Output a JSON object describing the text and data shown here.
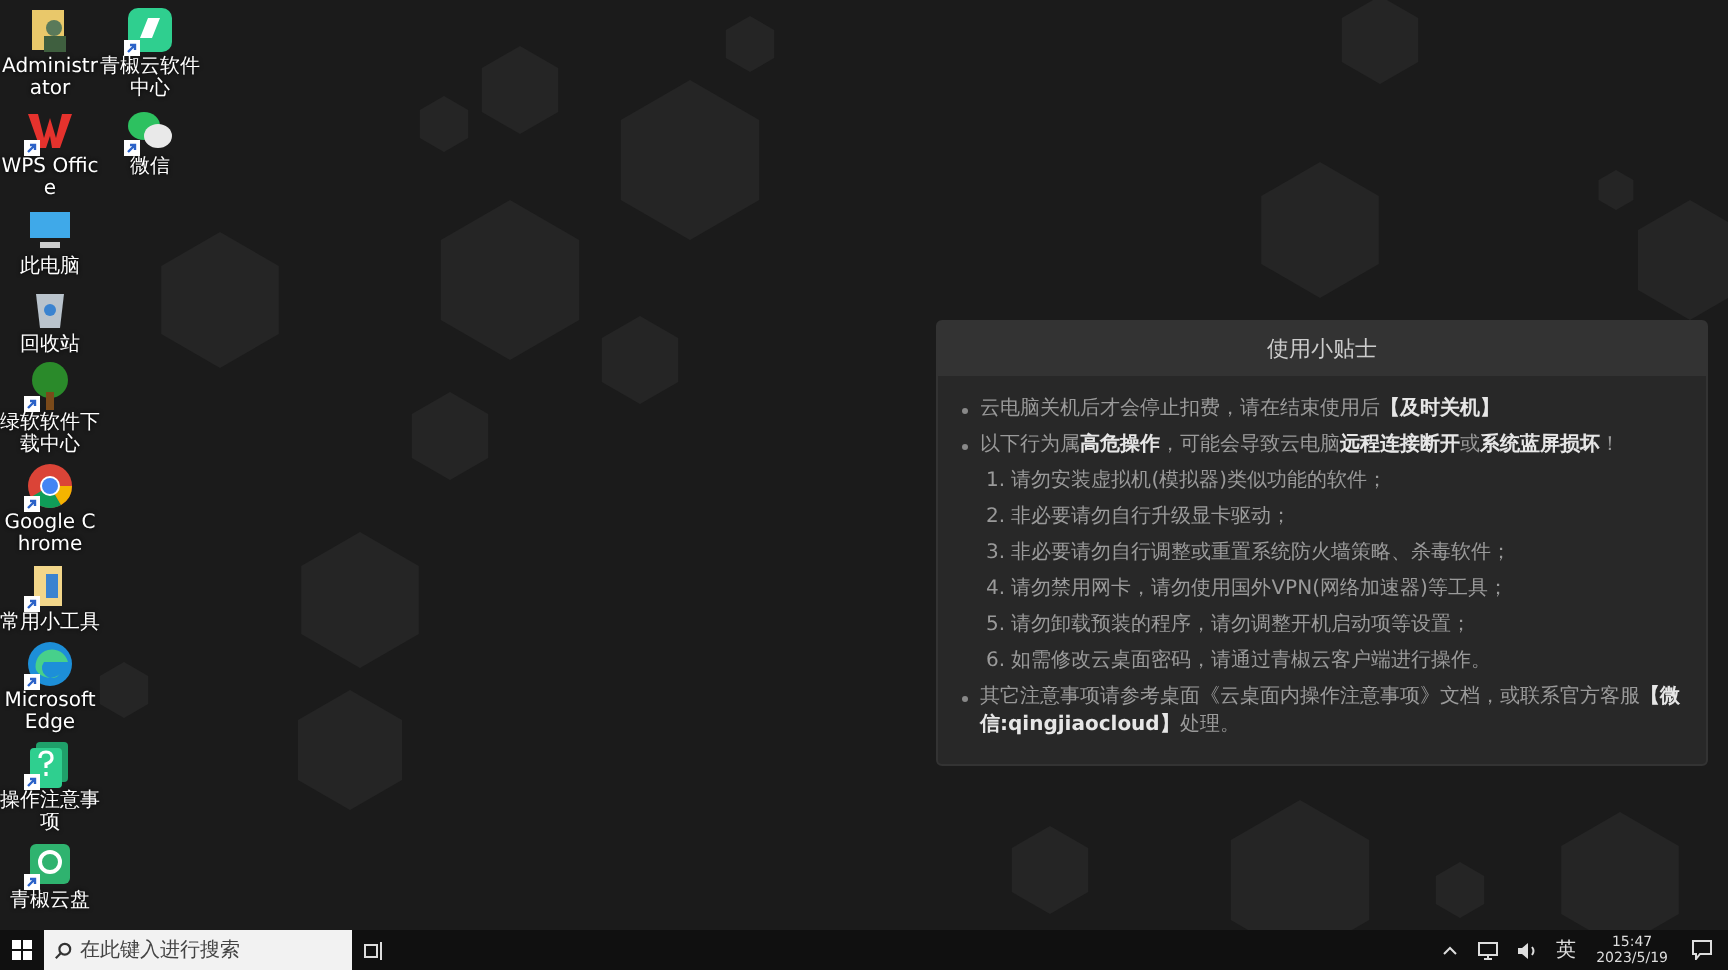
{
  "desktop": {
    "icon_rows": [
      {
        "icons": [
          {
            "label": "Administrator",
            "kind": "user-folder",
            "shortcut": false
          },
          {
            "label": "青椒云软件中心",
            "kind": "app-tile",
            "shortcut": true
          }
        ]
      },
      {
        "icons": [
          {
            "label": "WPS Office",
            "kind": "wps",
            "shortcut": true
          },
          {
            "label": "微信",
            "kind": "chat",
            "shortcut": true
          }
        ]
      },
      {
        "icons": [
          {
            "label": "此电脑",
            "kind": "computer",
            "shortcut": false
          }
        ]
      },
      {
        "icons": [
          {
            "label": "回收站",
            "kind": "recycle-bin",
            "shortcut": false
          }
        ]
      },
      {
        "icons": [
          {
            "label": "绿软软件下载中心",
            "kind": "tree",
            "shortcut": true
          }
        ]
      },
      {
        "icons": [
          {
            "label": "Google Chrome",
            "kind": "chrome",
            "shortcut": true
          }
        ]
      },
      {
        "icons": [
          {
            "label": "常用小工具",
            "kind": "folder",
            "shortcut": true
          }
        ]
      },
      {
        "icons": [
          {
            "label": "Microsoft Edge",
            "kind": "edge",
            "shortcut": true
          }
        ]
      },
      {
        "icons": [
          {
            "label": "操作注意事项",
            "kind": "help-doc",
            "shortcut": true
          }
        ]
      },
      {
        "icons": [
          {
            "label": "青椒云盘",
            "kind": "cloud-drive",
            "shortcut": true
          }
        ]
      }
    ]
  },
  "tips": {
    "title": "使用小贴士",
    "items": [
      {
        "kind": "bullet",
        "text": "云电脑关机后才会停止扣费，请在结束使用后**【及时关机】**"
      },
      {
        "kind": "bullet",
        "text": "以下行为属**高危操作**，可能会导致云电脑**远程连接断开**或**系统蓝屏损坏**！"
      },
      {
        "kind": "numbered",
        "text": "1. 请勿安装虚拟机(模拟器)类似功能的软件；"
      },
      {
        "kind": "numbered",
        "text": "2. 非必要请勿自行升级显卡驱动；"
      },
      {
        "kind": "numbered",
        "text": "3. 非必要请勿自行调整或重置系统防火墙策略、杀毒软件；"
      },
      {
        "kind": "numbered",
        "text": "4. 请勿禁用网卡，请勿使用国外VPN(网络加速器)等工具；"
      },
      {
        "kind": "numbered",
        "text": "5. 请勿卸载预装的程序，请勿调整开机启动项等设置；"
      },
      {
        "kind": "numbered",
        "text": "6. 如需修改云桌面密码，请通过青椒云客户端进行操作。"
      },
      {
        "kind": "bullet",
        "text": "其它注意事项请参考桌面《云桌面内操作注意事项》文档，或联系官方客服**【微信:qingjiaocloud】**处理。"
      }
    ]
  },
  "taskbar": {
    "search": {
      "placeholder": "在此键入进行搜索"
    },
    "tray": {
      "input_method": "英",
      "time": "15:47",
      "date": "2023/5/19"
    }
  }
}
